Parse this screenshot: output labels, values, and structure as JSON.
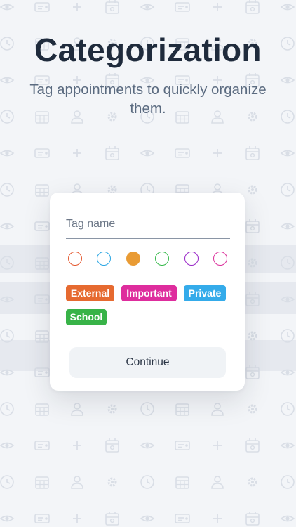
{
  "header": {
    "title": "Categorization",
    "subtitle": "Tag appointments to quickly organize them."
  },
  "tag_form": {
    "name_placeholder": "Tag name",
    "name_value": "",
    "colors": [
      {
        "name": "color-red",
        "hex": "#e4582f",
        "selected": false
      },
      {
        "name": "color-blue",
        "hex": "#2aa6e3",
        "selected": false
      },
      {
        "name": "color-orange",
        "hex": "#e99b34",
        "selected": true
      },
      {
        "name": "color-green",
        "hex": "#35b94a",
        "selected": false
      },
      {
        "name": "color-purple",
        "hex": "#9a28c8",
        "selected": false
      },
      {
        "name": "color-pink",
        "hex": "#db2f9b",
        "selected": false
      }
    ],
    "tags": [
      {
        "label": "External",
        "color": "#e66a30"
      },
      {
        "label": "Important",
        "color": "#de2d9d"
      },
      {
        "label": "Private",
        "color": "#34abea"
      },
      {
        "label": "School",
        "color": "#38b348"
      }
    ],
    "continue_label": "Continue"
  },
  "background": {
    "icons": [
      "eye-icon",
      "id-card-icon",
      "plus-icon",
      "calendar-icon",
      "clock-icon",
      "grid-calendar-icon",
      "person-icon",
      "gear-icon"
    ]
  }
}
